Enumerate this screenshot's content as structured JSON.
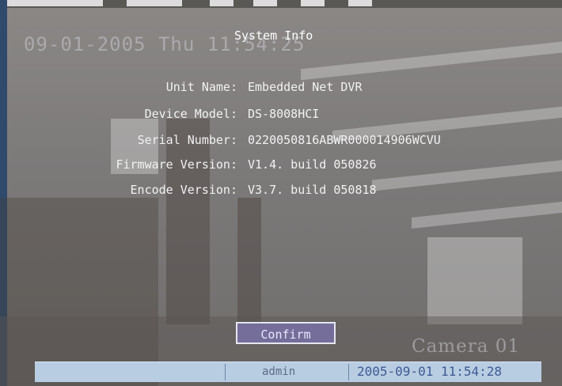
{
  "screen": {
    "osd_date": "09-01-2005 Thu 11:54:25",
    "camera_label": "Camera 01"
  },
  "dialog": {
    "title": "System Info",
    "rows": [
      {
        "label": "Unit Name:",
        "value": "Embedded Net DVR"
      },
      {
        "label": "Device Model:",
        "value": "DS-8008HCI"
      },
      {
        "label": "Serial Number:",
        "value": "0220050816ABWR000014906WCVU"
      },
      {
        "label": "Firmware Version:",
        "value": "V1.4. build 050826"
      },
      {
        "label": "Encode Version:",
        "value": "V3.7. build 050818"
      }
    ],
    "confirm_label": "Confirm"
  },
  "status_bar": {
    "user": "admin",
    "datetime": "2005-09-01 11:54:28"
  }
}
